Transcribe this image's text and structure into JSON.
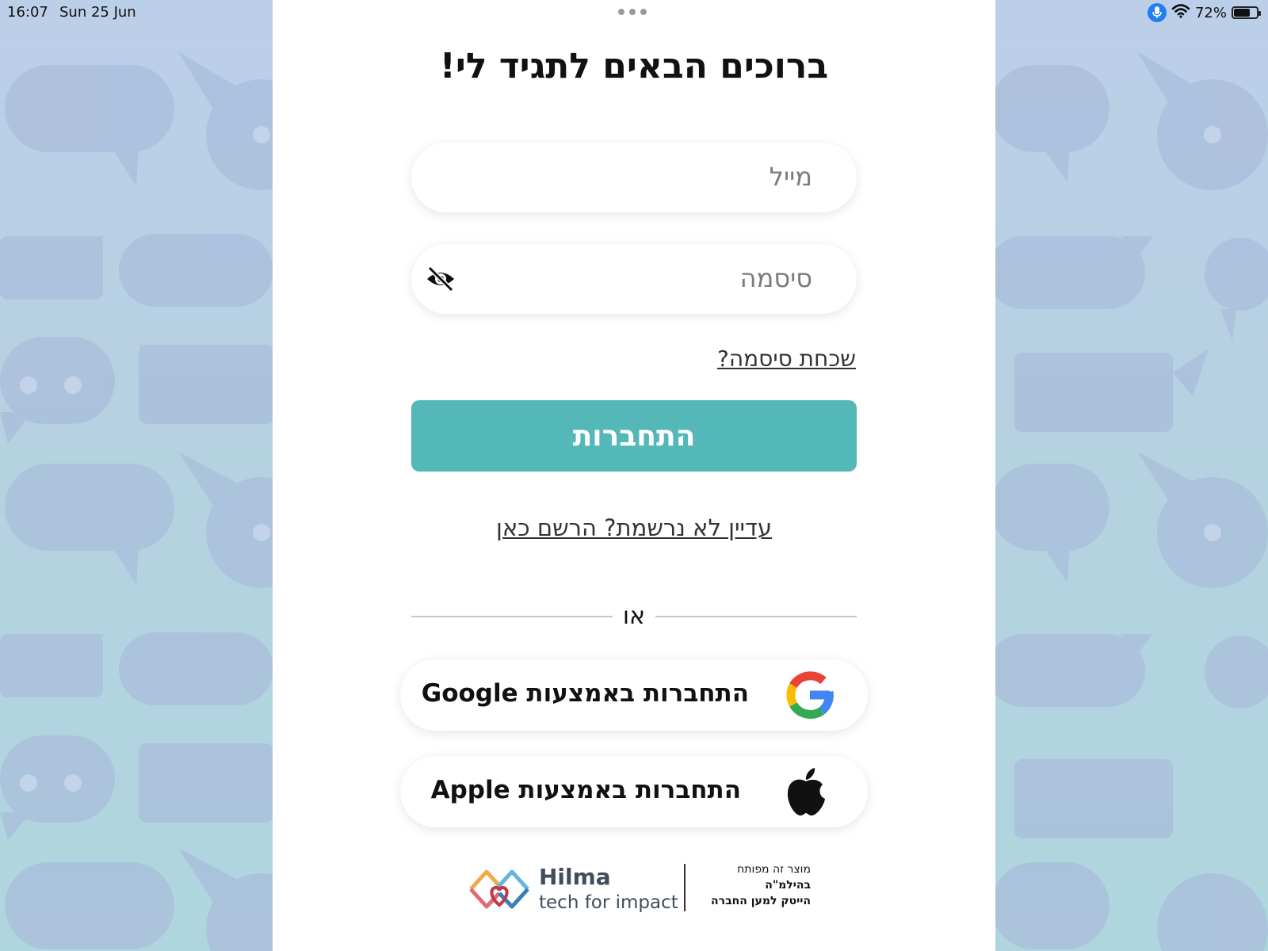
{
  "status_bar": {
    "time": "16:07",
    "date": "Sun 25 Jun",
    "battery_percent": "72%",
    "battery_level": 0.72
  },
  "login": {
    "title": "ברוכים הבאים לתגיד לי!",
    "email_placeholder": "מייל",
    "password_placeholder": "סיסמה",
    "forgot_password": "שכחת סיסמה?",
    "login_button": "התחברות",
    "register_link": "עדיין לא נרשמת? הרשם כאן",
    "divider_text": "או",
    "google_button": "התחברות באמצעות Google",
    "apple_button": "התחברות באמצעות Apple"
  },
  "footer": {
    "brand_name": "Hilma",
    "brand_tagline": "tech for impact",
    "text_line1": "מוצר זה מפותח",
    "text_line2": "בהילמ\"ה",
    "text_line3": "הייטק למען החברה"
  },
  "colors": {
    "accent": "#55b8b8",
    "background": "#bccfe9",
    "pattern": "#a9bedb"
  },
  "icons": {
    "password_toggle": "eye-slash-icon",
    "google": "google-icon",
    "apple": "apple-icon",
    "mic": "mic-icon",
    "wifi": "wifi-icon",
    "battery": "battery-icon"
  }
}
